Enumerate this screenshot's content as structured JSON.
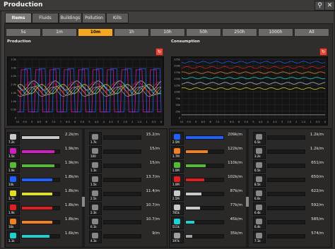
{
  "window": {
    "title": "Production",
    "search_icon": "search-icon",
    "close_icon": "close-icon"
  },
  "tabs": [
    "Items",
    "Fluids",
    "Buildings",
    "Pollution",
    "Kills"
  ],
  "active_tab": "Items",
  "time_ranges": [
    "5s",
    "1m",
    "10m",
    "1h",
    "10h",
    "50h",
    "250h",
    "1000h",
    "All"
  ],
  "active_time_range": "10m",
  "production": {
    "title": "Production",
    "y_ticks": [
      "3.5k",
      "3.0k",
      "2.5k",
      "2.0k",
      "1.5k",
      "1.0k",
      "0.5k",
      "0"
    ],
    "x_ticks": [
      "10",
      "9.5",
      "9",
      "8.5",
      "8",
      "7.5",
      "7",
      "6.5",
      "6",
      "5.5",
      "5",
      "4.5",
      "4",
      "3.5",
      "3",
      "2.5",
      "2",
      "1.5",
      "1",
      "0.5",
      "0"
    ],
    "series_colors": [
      "#c9c9c9",
      "#e02020",
      "#2060ff",
      "#d020c0",
      "#e0e020",
      "#20d0d0",
      "#f08020",
      "#a0a0a0"
    ]
  },
  "consumption": {
    "title": "Consumption",
    "y_ticks": [
      "225k",
      "200k",
      "175k",
      "150k",
      "125k",
      "100k",
      "75k",
      "50k",
      "25k",
      "0"
    ],
    "x_ticks": [
      "10",
      "9.5",
      "9",
      "8.5",
      "8",
      "7.5",
      "7",
      "6.5",
      "6",
      "5.5",
      "5",
      "4.5",
      "4",
      "3.5",
      "3",
      "2.5",
      "2",
      "1.5",
      "1",
      "0.5",
      "0"
    ],
    "series_colors": [
      "#2060ff",
      "#e02020",
      "#f08020",
      "#20d0d0",
      "#c9c9c9",
      "#e0e020",
      "#a0a0a0"
    ]
  },
  "production_items": [
    {
      "icon": "iron-plate-icon",
      "count": "7.2k",
      "value": "2.2k/m",
      "fill": 1.0,
      "color": "#c9c9c9"
    },
    {
      "icon": "flask-icon",
      "count": "1.5k",
      "value": "1.9k/m",
      "fill": 0.86,
      "color": "#d020c0"
    },
    {
      "icon": "flask-icon",
      "count": "1.9k",
      "value": "1.9k/m",
      "fill": 0.86,
      "color": "#55bb33"
    },
    {
      "icon": "flask-icon",
      "count": "14k",
      "value": "1.8k/m",
      "fill": 0.82,
      "color": "#2060ff"
    },
    {
      "icon": "flask-icon",
      "count": "1.1k",
      "value": "1.8k/m",
      "fill": 0.82,
      "color": "#e0e020"
    },
    {
      "icon": "flask-icon",
      "count": "1.9k",
      "value": "1.8k/m",
      "fill": 0.82,
      "color": "#e02020"
    },
    {
      "icon": "flask-icon",
      "count": "16k",
      "value": "1.8k/m",
      "fill": 0.82,
      "color": "#f08020"
    },
    {
      "icon": "flask-icon",
      "count": "1.1k",
      "value": "1.6k/m",
      "fill": 0.73,
      "color": "#20d0d0"
    }
  ],
  "production_items_2": [
    {
      "icon": "rail-icon",
      "count": "1.7k",
      "value": "15.2/m",
      "fill": 0.0,
      "color": "#888888"
    },
    {
      "icon": "stick-icon",
      "count": "100",
      "value": "15/m",
      "fill": 0.0,
      "color": "#888888"
    },
    {
      "icon": "stick-icon",
      "count": "1.1k",
      "value": "15/m",
      "fill": 0.0,
      "color": "#888888"
    },
    {
      "icon": "engine-icon",
      "count": "1.5k",
      "value": "13.7/m",
      "fill": 0.0,
      "color": "#888888"
    },
    {
      "icon": "robot-icon",
      "count": "2.5k",
      "value": "11.4/m",
      "fill": 0.0,
      "color": "#888888"
    },
    {
      "icon": "furnace-icon",
      "count": "2.3k",
      "value": "10.7/m",
      "fill": 0.0,
      "color": "#888888"
    },
    {
      "icon": "module-icon",
      "count": "6.1k",
      "value": "10.7/m",
      "fill": 0.0,
      "color": "#888888"
    },
    {
      "icon": "robot-icon",
      "count": "4.1k",
      "value": "9/m",
      "fill": 0.0,
      "color": "#888888"
    }
  ],
  "consumption_items": [
    {
      "icon": "iron-ore-icon",
      "count": "2.5M",
      "value": "209k/m",
      "fill": 1.0,
      "color": "#2060ff"
    },
    {
      "icon": "copper-ore-icon",
      "count": "1.7M",
      "value": "122k/m",
      "fill": 0.58,
      "color": "#f08020"
    },
    {
      "icon": "water-icon",
      "count": "1.0M",
      "value": "110k/m",
      "fill": 0.53,
      "color": "#55bb33"
    },
    {
      "icon": "coal-icon",
      "count": "1.0M",
      "value": "102k/m",
      "fill": 0.49,
      "color": "#e02020"
    },
    {
      "icon": "oil-icon",
      "count": "2.5M",
      "value": "87k/m",
      "fill": 0.42,
      "color": "#c9c9c9"
    },
    {
      "icon": "circuit-icon",
      "count": "765k",
      "value": "77k/m",
      "fill": 0.37,
      "color": "#c9c9c9"
    },
    {
      "icon": "circuit-icon",
      "count": "515k",
      "value": "45k/m",
      "fill": 0.22,
      "color": "#20d0d0"
    },
    {
      "icon": "stone-icon",
      "count": "197k",
      "value": "35k/m",
      "fill": 0.17,
      "color": "#a0a0a0"
    }
  ],
  "consumption_items_2": [
    {
      "icon": "gear-icon",
      "count": "6.5k",
      "value": "1.2k/m",
      "fill": 0.0,
      "color": "#888888"
    },
    {
      "icon": "gear-icon",
      "count": "3.2k",
      "value": "1.2k/m",
      "fill": 0.0,
      "color": "#888888"
    },
    {
      "icon": "pipe-icon",
      "count": "6.5k",
      "value": "651/m",
      "fill": 0.0,
      "color": "#888888"
    },
    {
      "icon": "gear-icon",
      "count": "8.5k",
      "value": "650/m",
      "fill": 0.0,
      "color": "#888888"
    },
    {
      "icon": "gear-icon",
      "count": "6.6k",
      "value": "622/m",
      "fill": 0.0,
      "color": "#888888"
    },
    {
      "icon": "gear-icon",
      "count": "6.4k",
      "value": "592/m",
      "fill": 0.0,
      "color": "#888888"
    },
    {
      "icon": "gear-icon",
      "count": "6.4k",
      "value": "585/m",
      "fill": 0.0,
      "color": "#888888"
    },
    {
      "icon": "gear-icon",
      "count": "7.1k",
      "value": "574/m",
      "fill": 0.0,
      "color": "#888888"
    }
  ]
}
